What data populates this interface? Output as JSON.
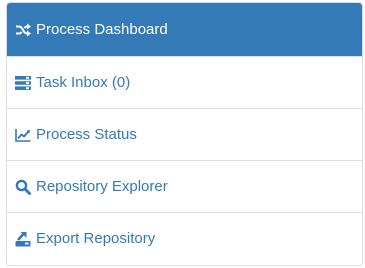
{
  "nav": {
    "items": [
      {
        "label": "Process Dashboard",
        "icon": "random-icon",
        "active": true
      },
      {
        "label": "Task Inbox (0)",
        "icon": "tasks-icon",
        "active": false
      },
      {
        "label": "Process Status",
        "icon": "line-chart-icon",
        "active": false
      },
      {
        "label": "Repository Explorer",
        "icon": "search-icon",
        "active": false
      },
      {
        "label": "Export Repository",
        "icon": "export-icon",
        "active": false
      }
    ]
  },
  "colors": {
    "accent": "#337ab7",
    "active_text": "#ffffff",
    "border": "#dddddd"
  }
}
